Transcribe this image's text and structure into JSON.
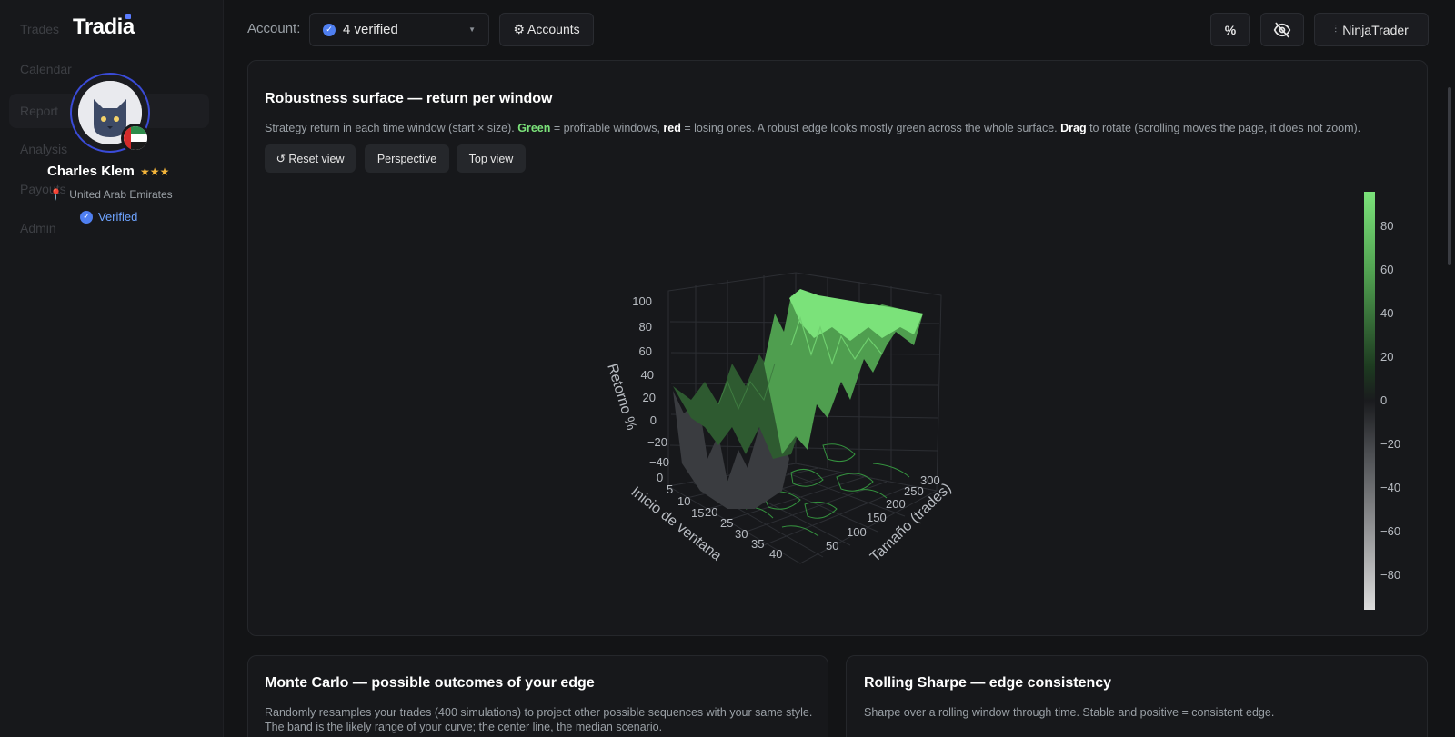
{
  "sidebar": {
    "brand": "Tradia",
    "nav": [
      {
        "label": "Trades"
      },
      {
        "label": "Calendar"
      },
      {
        "label": "Report"
      },
      {
        "label": "Analysis"
      },
      {
        "label": "Payouts"
      },
      {
        "label": "Admin"
      }
    ],
    "profile": {
      "name": "Charles Klem",
      "stars": "★★★",
      "location": "United Arab Emirates",
      "verified_label": "Verified"
    }
  },
  "topbar": {
    "account_label": "Account:",
    "account_value": "4 verified",
    "accounts_button": "⚙ Accounts",
    "percent_button": "%",
    "platform_button": "NinjaTrader"
  },
  "robustness": {
    "title": "Robustness surface — return per window",
    "desc_1": "Strategy return in each time window (start × size). ",
    "desc_green": "Green",
    "desc_2": " = profitable windows, ",
    "desc_red": "red",
    "desc_3": " = losing ones. A robust edge looks mostly green across the whole surface. ",
    "desc_drag": "Drag",
    "desc_4": " to rotate (scrolling moves the page, it does not zoom).",
    "buttons": {
      "reset": "↺ Reset view",
      "perspective": "Perspective",
      "top": "Top view"
    }
  },
  "chart_data": {
    "type": "heatmap",
    "title": "",
    "xlabel": "Inicio de ventana",
    "ylabel": "Tamaño (trades)",
    "zlabel": "Retorno %",
    "x_ticks": [
      "0",
      "5",
      "10",
      "15",
      "20",
      "25",
      "30",
      "35",
      "40"
    ],
    "y_ticks": [
      "50",
      "100",
      "150",
      "200",
      "250",
      "300"
    ],
    "z_ticks": [
      "100",
      "80",
      "60",
      "40",
      "20",
      "0",
      "−20",
      "−40"
    ],
    "colorbar_ticks": [
      "80",
      "60",
      "40",
      "20",
      "0",
      "−20",
      "−40",
      "−60",
      "−80"
    ],
    "colorscale": {
      "positive": "#7be27a",
      "zero": "#1a1b1e",
      "negative": "#d9d9d9"
    }
  },
  "montecarlo": {
    "title": "Monte Carlo — possible outcomes of your edge",
    "desc": "Randomly resamples your trades (400 simulations) to project other possible sequences with your same style. The band is the likely range of your curve; the center line, the median scenario."
  },
  "rolling": {
    "title": "Rolling Sharpe — edge consistency",
    "desc": "Sharpe over a rolling window through time. Stable and positive = consistent edge."
  }
}
